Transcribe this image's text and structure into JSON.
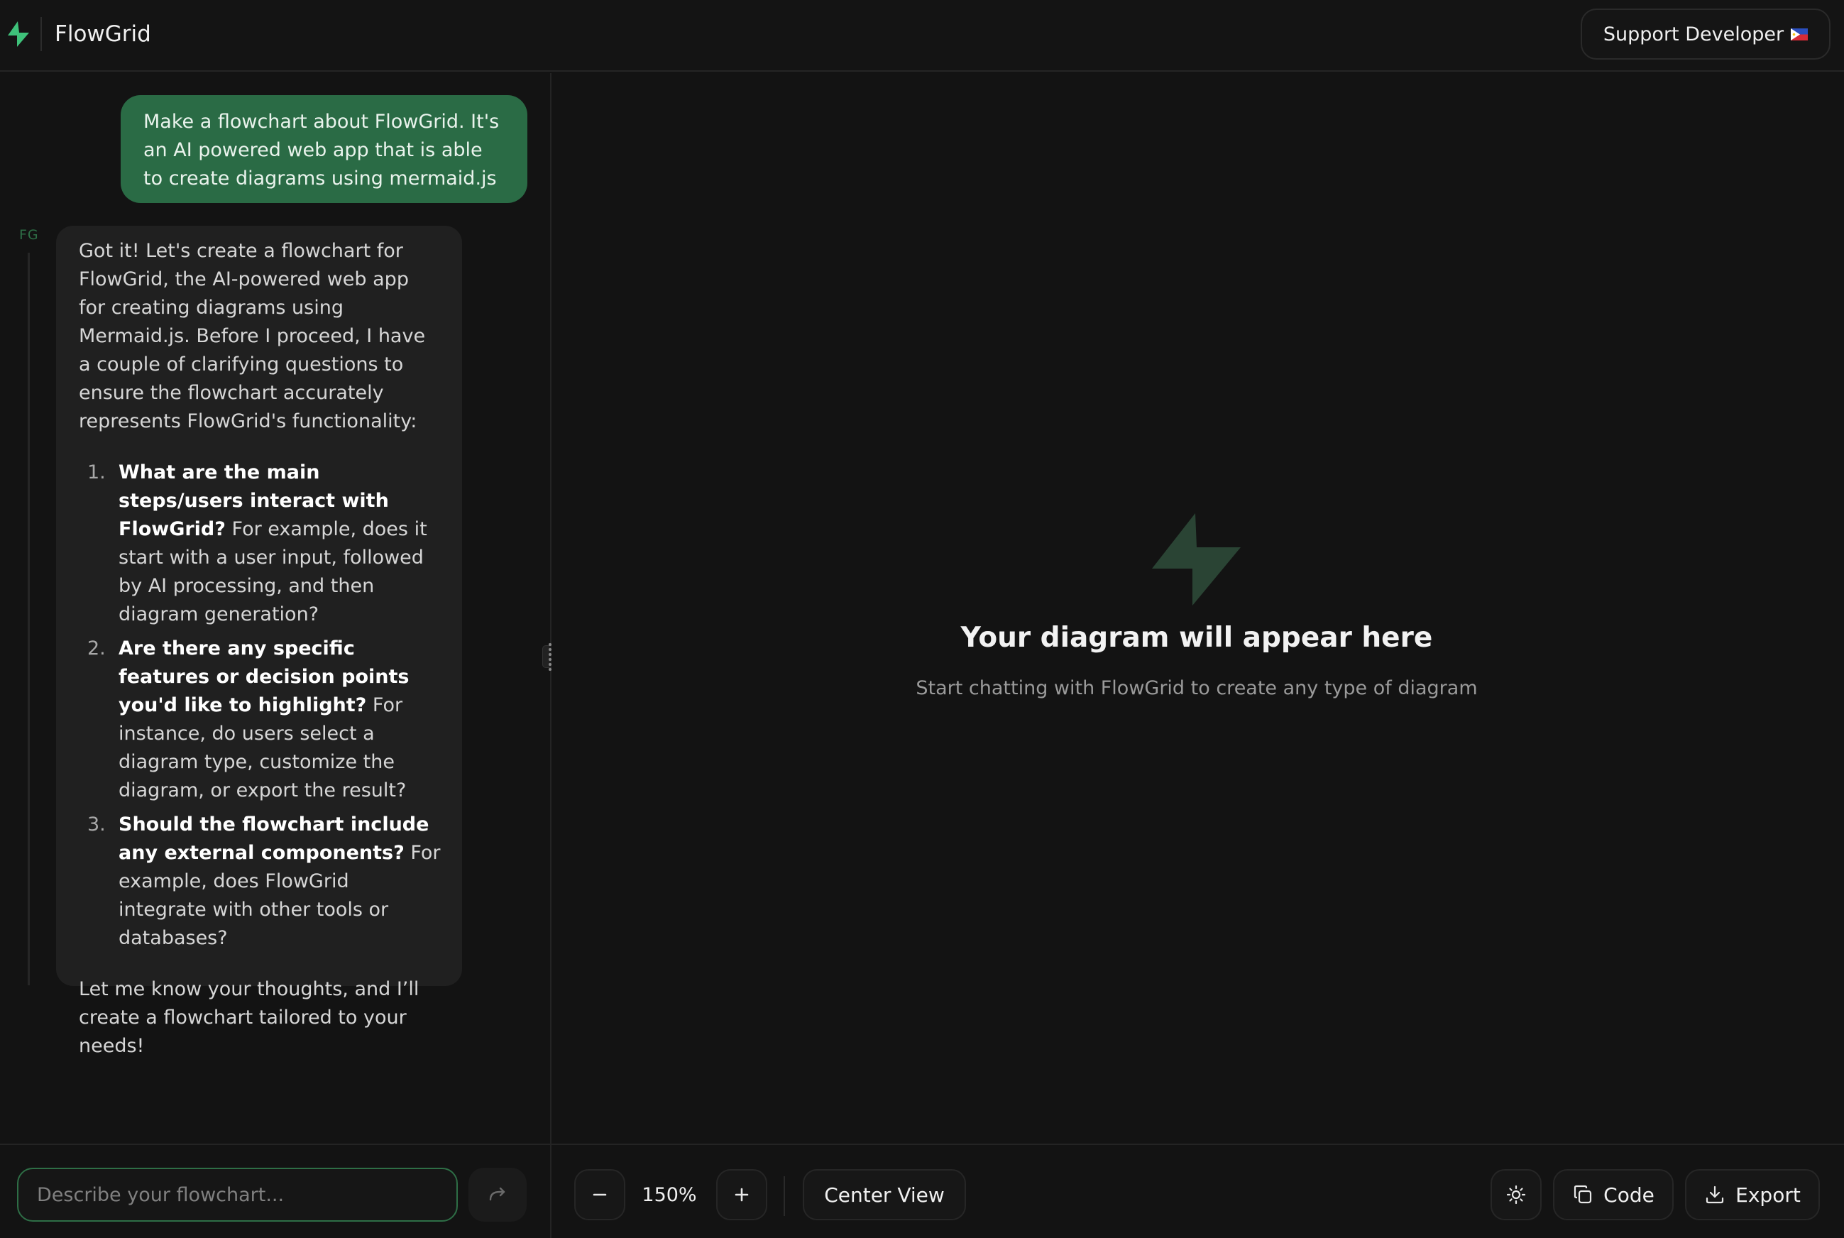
{
  "header": {
    "app_name": "FlowGrid",
    "support_button": "Support Developer"
  },
  "chat": {
    "user_message": "Make a flowchart about FlowGrid. It's an AI powered web app that is able to create diagrams using mermaid.js",
    "assistant_label": "FG",
    "assistant_intro": "Got it! Let's create a flowchart for FlowGrid, the AI-powered web app for creating diagrams using Mermaid.js. Before I proceed, I have a couple of clarifying questions to ensure the flowchart accurately represents FlowGrid's functionality:",
    "questions": [
      {
        "number": "1.",
        "bold": "What are the main steps/users interact with FlowGrid?",
        "text": " For example, does it start with a user input, followed by AI processing, and then diagram generation?"
      },
      {
        "number": "2.",
        "bold": "Are there any specific features or decision points you'd like to highlight?",
        "text": " For instance, do users select a diagram type, customize the diagram, or export the result?"
      },
      {
        "number": "3.",
        "bold": "Should the flowchart include any external components?",
        "text": " For example, does FlowGrid integrate with other tools or databases?"
      }
    ],
    "assistant_outro": "Let me know your thoughts, and I’ll create a flowchart tailored to your needs!",
    "input_placeholder": "Describe your flowchart..."
  },
  "canvas": {
    "empty_title": "Your diagram will appear here",
    "empty_subtitle": "Start chatting with FlowGrid to create any type of diagram"
  },
  "toolbar": {
    "zoom_level": "150%",
    "center_view": "Center View",
    "code": "Code",
    "export": "Export"
  },
  "icons": {
    "logo": "bolt-icon",
    "flag": "philippines-flag-icon",
    "send": "forward-arrow-icon",
    "zoom_out": "minus-icon",
    "zoom_in": "plus-icon",
    "theme": "sun-icon",
    "code": "copy-icon",
    "export": "download-icon"
  },
  "colors": {
    "accent_green": "#2a6b45",
    "logo_green": "#3ec27a",
    "background": "#131313",
    "bubble": "#202020"
  }
}
